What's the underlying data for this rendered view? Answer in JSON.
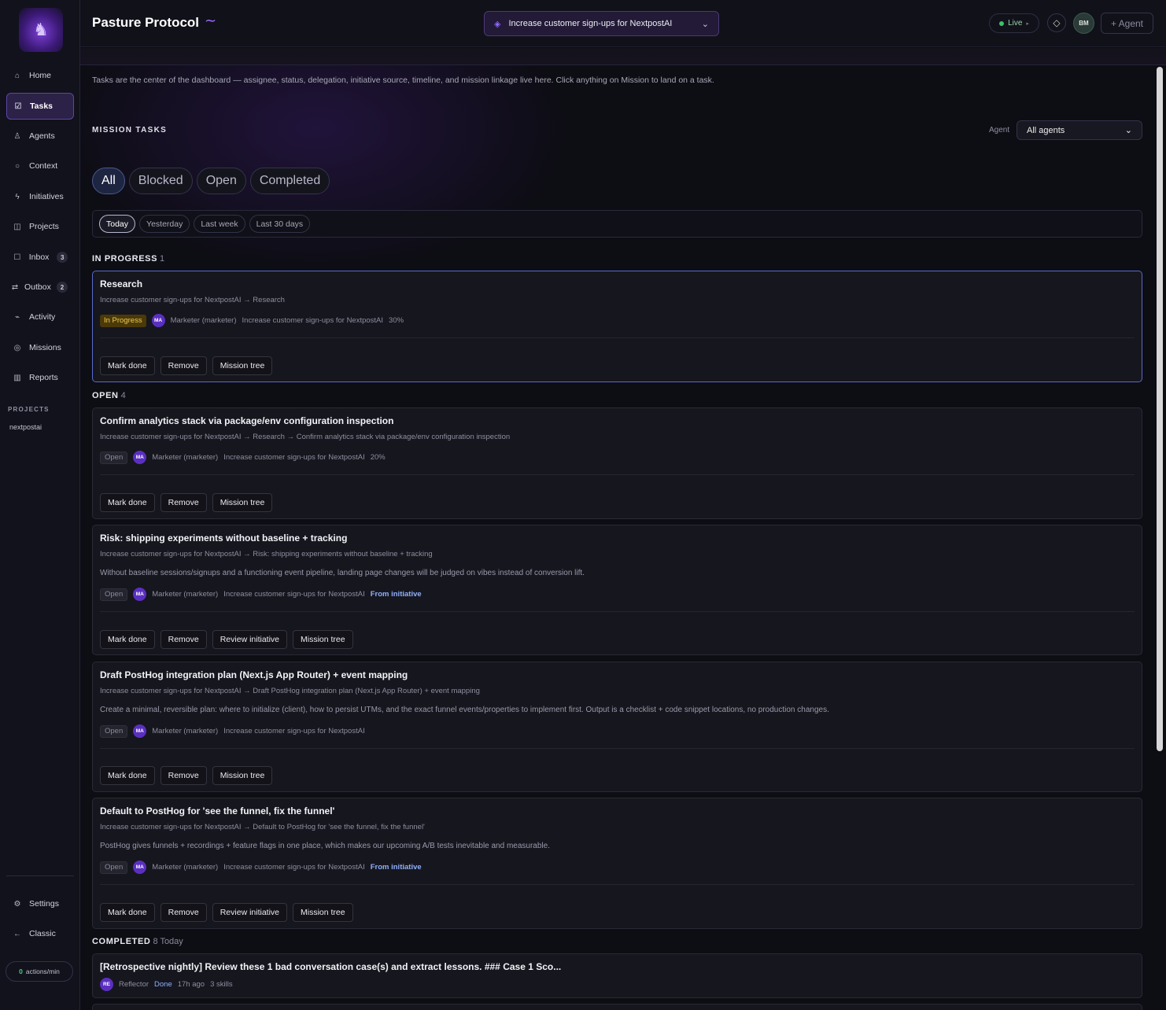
{
  "app": {
    "title": "Pasture Protocol",
    "mission_selector": "Increase customer sign-ups for NextpostAI",
    "live_label": "Live",
    "user_initials": "BM",
    "add_agent_label": "+ Agent"
  },
  "sidebar": {
    "items": [
      {
        "label": "Home",
        "icon": "home-icon"
      },
      {
        "label": "Tasks",
        "icon": "checkbox-icon",
        "active": true
      },
      {
        "label": "Agents",
        "icon": "agent-icon"
      },
      {
        "label": "Context",
        "icon": "context-icon"
      },
      {
        "label": "Initiatives",
        "icon": "bolt-icon"
      },
      {
        "label": "Projects",
        "icon": "columns-icon"
      },
      {
        "label": "Inbox",
        "icon": "inbox-icon",
        "badge": "3"
      },
      {
        "label": "Outbox",
        "icon": "arrows-icon",
        "badge": "2"
      },
      {
        "label": "Activity",
        "icon": "pulse-icon"
      },
      {
        "label": "Missions",
        "icon": "target-icon"
      },
      {
        "label": "Reports",
        "icon": "table-icon"
      }
    ],
    "projects_heading": "PROJECTS",
    "projects": [
      "nextpostai"
    ],
    "bottom_items": [
      {
        "label": "Settings",
        "icon": "gear-icon"
      },
      {
        "label": "Classic",
        "icon": "arrow-left-icon"
      }
    ],
    "actions_per_min": {
      "value": "0",
      "label": "actions/min"
    }
  },
  "main": {
    "intro": "Tasks are the center of the dashboard — assignee, status, delegation, initiative source, timeline, and mission linkage live here. Click anything on Mission to land on a task.",
    "section_title": "MISSION TASKS",
    "agent_filter_label": "Agent",
    "agent_filter_value": "All agents",
    "status_tabs": [
      "All",
      "Blocked",
      "Open",
      "Completed"
    ],
    "date_filters": [
      "Today",
      "Yesterday",
      "Last week",
      "Last 30 days"
    ],
    "in_progress": {
      "label": "IN PROGRESS",
      "count": "1",
      "task": {
        "title": "Research",
        "path": "Increase customer sign-ups for NextpostAI → Research",
        "status": "In Progress",
        "avatar": "MA",
        "agent": "Marketer (marketer)",
        "mission": "Increase customer sign-ups for NextpostAI",
        "progress": "30%",
        "actions": [
          "Mark done",
          "Remove",
          "Mission tree"
        ]
      }
    },
    "open": {
      "label": "OPEN",
      "count": "4",
      "tasks": [
        {
          "title": "Confirm analytics stack via package/env configuration inspection",
          "path": "Increase customer sign-ups for NextpostAI → Research → Confirm analytics stack via package/env configuration inspection",
          "status": "Open",
          "avatar": "MA",
          "agent": "Marketer (marketer)",
          "mission": "Increase customer sign-ups for NextpostAI",
          "progress": "20%",
          "actions": [
            "Mark done",
            "Remove",
            "Mission tree"
          ]
        },
        {
          "title": "Risk: shipping experiments without baseline + tracking",
          "path": "Increase customer sign-ups for NextpostAI → Risk: shipping experiments without baseline + tracking",
          "description": "Without baseline sessions/signups and a functioning event pipeline, landing page changes will be judged on vibes instead of conversion lift.",
          "status": "Open",
          "avatar": "MA",
          "agent": "Marketer (marketer)",
          "mission": "Increase customer sign-ups for NextpostAI",
          "source": "From initiative",
          "actions": [
            "Mark done",
            "Remove",
            "Review initiative",
            "Mission tree"
          ]
        },
        {
          "title": "Draft PostHog integration plan (Next.js App Router) + event mapping",
          "path": "Increase customer sign-ups for NextpostAI → Draft PostHog integration plan (Next.js App Router) + event mapping",
          "description": "Create a minimal, reversible plan: where to initialize (client), how to persist UTMs, and the exact funnel events/properties to implement first. Output is a checklist + code snippet locations, no production changes.",
          "status": "Open",
          "avatar": "MA",
          "agent": "Marketer (marketer)",
          "mission": "Increase customer sign-ups for NextpostAI",
          "actions": [
            "Mark done",
            "Remove",
            "Mission tree"
          ]
        },
        {
          "title": "Default to PostHog for 'see the funnel, fix the funnel'",
          "path": "Increase customer sign-ups for NextpostAI → Default to PostHog for 'see the funnel, fix the funnel'",
          "description": "PostHog gives funnels + recordings + feature flags in one place, which makes our upcoming A/B tests inevitable and measurable.",
          "status": "Open",
          "avatar": "MA",
          "agent": "Marketer (marketer)",
          "mission": "Increase customer sign-ups for NextpostAI",
          "source": "From initiative",
          "actions": [
            "Mark done",
            "Remove",
            "Review initiative",
            "Mission tree"
          ]
        }
      ]
    },
    "completed": {
      "label": "COMPLETED",
      "count": "8 Today",
      "tasks": [
        {
          "title": "[Retrospective nightly] Review these 1 bad conversation case(s) and extract lessons. ### Case 1 Sco...",
          "avatar": "RE",
          "agent": "Reflector",
          "status": "Done",
          "time": "17h ago",
          "skills": "3 skills"
        }
      ]
    }
  },
  "colors": {
    "accent": "#7b3fd6",
    "in_progress_badge": "#f2c94c",
    "link": "#8fb0ff",
    "live": "#3fbf6a"
  }
}
